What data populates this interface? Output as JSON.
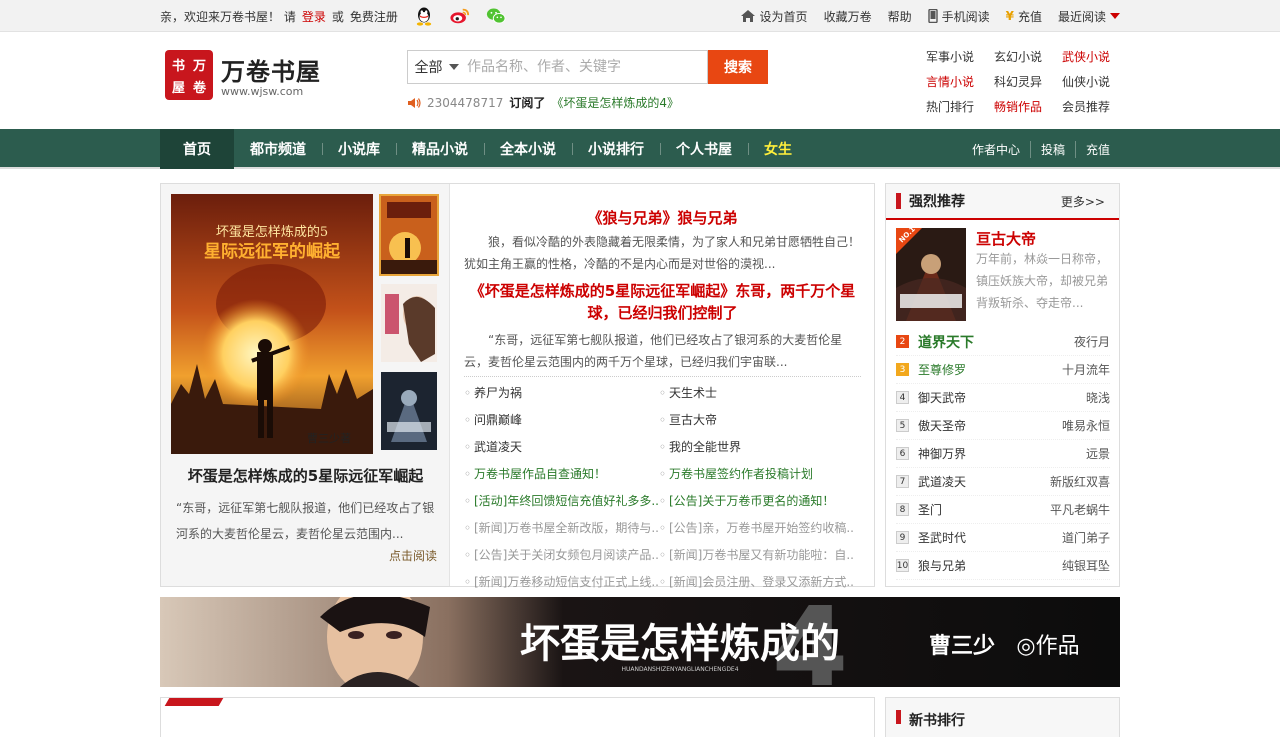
{
  "topbar": {
    "welcome": "亲，欢迎来万卷书屋！ 请",
    "login": "登录",
    "or": "或",
    "register": "免费注册",
    "social_icons": [
      "qq-icon",
      "weibo-icon",
      "wechat-icon"
    ],
    "links": [
      {
        "label": "设为首页",
        "icon": "home-icon"
      },
      {
        "label": "收藏万卷",
        "icon": ""
      },
      {
        "label": "帮助",
        "icon": ""
      },
      {
        "label": "手机阅读",
        "icon": "mobile-icon"
      },
      {
        "label": "充值",
        "icon": "yen-icon"
      },
      {
        "label": "最近阅读",
        "icon": "chevron-down-icon"
      }
    ]
  },
  "logo": {
    "seal": [
      "书",
      "万",
      "屋",
      "卷"
    ],
    "name": "万卷书屋",
    "url": "www.wjsw.com"
  },
  "search": {
    "category": "全部",
    "placeholder": "作品名称、作者、关键字",
    "button": "搜索",
    "sub_user": "2304478717",
    "sub_action": "订阅了",
    "sub_book": "《坏蛋是怎样炼成的4》"
  },
  "categories": [
    {
      "label": "军事小说",
      "hl": false
    },
    {
      "label": "玄幻小说",
      "hl": false
    },
    {
      "label": "武侠小说",
      "hl": true
    },
    {
      "label": "言情小说",
      "hl": true
    },
    {
      "label": "科幻灵异",
      "hl": false
    },
    {
      "label": "仙侠小说",
      "hl": false
    },
    {
      "label": "热门排行",
      "hl": false
    },
    {
      "label": "畅销作品",
      "hl": true
    },
    {
      "label": "会员推荐",
      "hl": false
    }
  ],
  "nav": {
    "items": [
      "首页",
      "都市频道",
      "小说库",
      "精品小说",
      "全本小说",
      "小说排行",
      "个人书屋",
      "女生"
    ],
    "right": [
      "作者中心",
      "投稿",
      "充值"
    ]
  },
  "featured": {
    "cover_title_1": "坏蛋是怎样炼成的5",
    "cover_title_2": "星际远征军的崛起",
    "cover_author": "曹三少著",
    "title": "坏蛋是怎样炼成的5星际远征军崛起",
    "desc": "“东哥，远征军第七舰队报道，他们已经攻占了银河系的大麦哲伦星云，麦哲伦星云范围内...",
    "more": "点击阅读",
    "news1_title": "《狼与兄弟》狼与兄弟",
    "news1_text": "狼，看似冷酷的外表隐藏着无限柔情，为了家人和兄弟甘愿牺牲自己！犹如主角王赢的性格，冷酷的不是内心而是对世俗的漠视...",
    "news2_title": "《坏蛋是怎样炼成的5星际远征军崛起》东哥，两千万个星球，已经归我们控制了",
    "news2_text": "“东哥，远征军第七舰队报道，他们已经攻占了银河系的大麦哲伦星云，麦哲伦星云范围内的两千万个星球，已经归我们宇宙联...",
    "links": [
      {
        "text": "养尸为祸",
        "style": ""
      },
      {
        "text": "天生术士",
        "style": ""
      },
      {
        "text": "问鼎巅峰",
        "style": ""
      },
      {
        "text": "亘古大帝",
        "style": ""
      },
      {
        "text": "武道凌天",
        "style": ""
      },
      {
        "text": "我的全能世界",
        "style": ""
      },
      {
        "text": "万卷书屋作品自查通知！",
        "style": "g"
      },
      {
        "text": "万卷书屋签约作者投稿计划",
        "style": "g"
      },
      {
        "text": "[活动]年终回馈短信充值好礼多多...",
        "style": "g"
      },
      {
        "text": "[公告]关于万卷币更名的通知！",
        "style": "g"
      },
      {
        "text": "[新闻]万卷书屋全新改版，期待与...",
        "style": "gray"
      },
      {
        "text": "[公告]亲，万卷书屋开始签约收稿...",
        "style": "gray"
      },
      {
        "text": "[公告]关于关闭女频包月阅读产品...",
        "style": "gray"
      },
      {
        "text": "[新闻]万卷书屋又有新功能啦：自...",
        "style": "gray"
      },
      {
        "text": "[新闻]万卷移动短信支付正式上线...",
        "style": "gray"
      },
      {
        "text": "[新闻]会员注册、登录又添新方式...",
        "style": "gray"
      }
    ]
  },
  "rank": {
    "title": "强烈推荐",
    "more": "更多>>",
    "top1_badge": "NO.1",
    "top1_title": "亘古大帝",
    "top1_desc": "万年前，林焱一日称帝，镇压妖族大帝，却被兄弟背叛斩杀、夺走帝...",
    "rows": [
      {
        "num": "2",
        "name": "道界天下",
        "author": "夜行月",
        "style": "big"
      },
      {
        "num": "3",
        "name": "至尊修罗",
        "author": "十月流年",
        "style": "g"
      },
      {
        "num": "4",
        "name": "御天武帝",
        "author": "晓浅",
        "style": ""
      },
      {
        "num": "5",
        "name": "傲天圣帝",
        "author": "唯易永恒",
        "style": ""
      },
      {
        "num": "6",
        "name": "神御万界",
        "author": "远景",
        "style": ""
      },
      {
        "num": "7",
        "name": "武道凌天",
        "author": "新版红双喜",
        "style": ""
      },
      {
        "num": "8",
        "name": "圣门",
        "author": "平凡老蜗牛",
        "style": ""
      },
      {
        "num": "9",
        "name": "圣武时代",
        "author": "道门弟子",
        "style": ""
      },
      {
        "num": "10",
        "name": "狼与兄弟",
        "author": "纯银耳坠",
        "style": ""
      }
    ]
  },
  "banner": {
    "title": "坏蛋是怎样炼成的",
    "number": "4",
    "pinyin": "HUANDANSHIZENYANGLIANCHENGDE4",
    "author": "曹三少",
    "works": "◎作品"
  },
  "bottom": {
    "right_title": "新书排行"
  },
  "colors": {
    "nav_bg": "#2c5c4e",
    "accent_red": "#c8161d",
    "search_btn": "#e84712",
    "link_green": "#2a7a2a"
  }
}
